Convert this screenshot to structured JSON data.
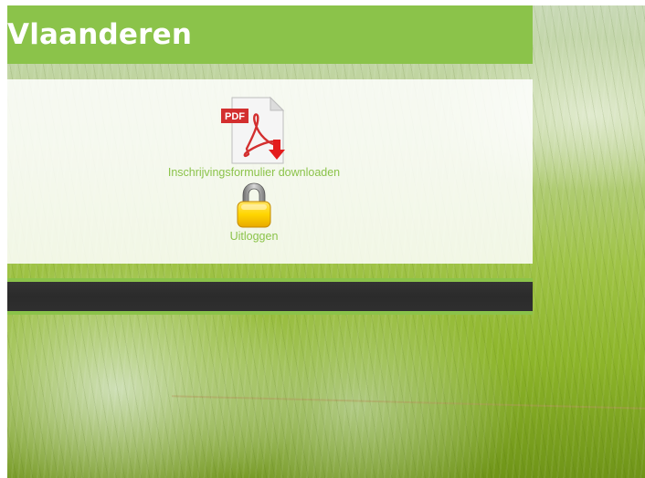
{
  "header": {
    "title": "Vlaanderen"
  },
  "links": {
    "pdf_download_label": "Inschrijvingsformulier downloaden",
    "pdf_badge": "PDF",
    "logout_label": "Uitloggen"
  },
  "icons": {
    "pdf": "pdf-download-icon",
    "logout": "padlock-icon"
  },
  "colors": {
    "accent_green": "#8bc34a",
    "dark_bar": "#2f2f2f",
    "link_text": "#8bc34a"
  }
}
